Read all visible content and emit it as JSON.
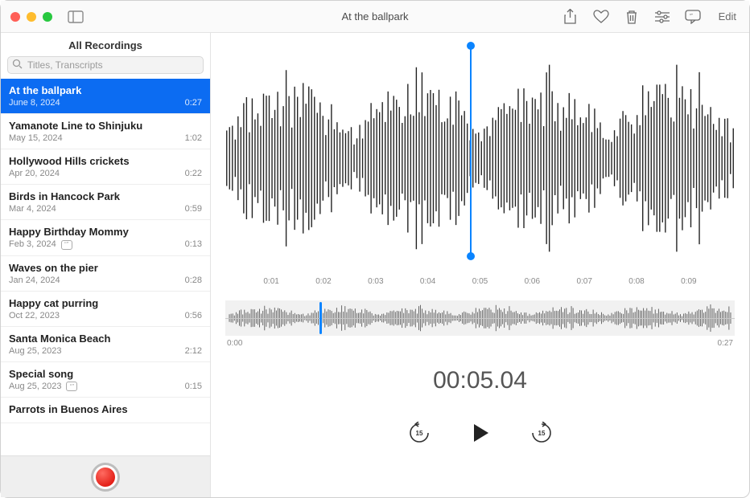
{
  "window": {
    "title": "At the ballpark",
    "edit_label": "Edit"
  },
  "sidebar": {
    "header": "All Recordings",
    "search_placeholder": "Titles, Transcripts",
    "recordings": [
      {
        "title": "At the ballpark",
        "date": "June 8, 2024",
        "duration": "0:27",
        "selected": true,
        "badge": false
      },
      {
        "title": "Yamanote Line to Shinjuku",
        "date": "May 15, 2024",
        "duration": "1:02",
        "selected": false,
        "badge": false
      },
      {
        "title": "Hollywood Hills crickets",
        "date": "Apr 20, 2024",
        "duration": "0:22",
        "selected": false,
        "badge": false
      },
      {
        "title": "Birds in Hancock Park",
        "date": "Mar 4, 2024",
        "duration": "0:59",
        "selected": false,
        "badge": false
      },
      {
        "title": "Happy Birthday Mommy",
        "date": "Feb 3, 2024",
        "duration": "0:13",
        "selected": false,
        "badge": true
      },
      {
        "title": "Waves on the pier",
        "date": "Jan 24, 2024",
        "duration": "0:28",
        "selected": false,
        "badge": false
      },
      {
        "title": "Happy cat purring",
        "date": "Oct 22, 2023",
        "duration": "0:56",
        "selected": false,
        "badge": false
      },
      {
        "title": "Santa Monica Beach",
        "date": "Aug 25, 2023",
        "duration": "2:12",
        "selected": false,
        "badge": false
      },
      {
        "title": "Special song",
        "date": "Aug 25, 2023",
        "duration": "0:15",
        "selected": false,
        "badge": true
      },
      {
        "title": "Parrots in Buenos Aires",
        "date": "",
        "duration": "",
        "selected": false,
        "badge": false
      }
    ]
  },
  "detail": {
    "axis_ticks": [
      "",
      "0:01",
      "0:02",
      "0:03",
      "0:04",
      "0:05",
      "0:06",
      "0:07",
      "0:08",
      "0:09",
      ""
    ],
    "overview_start": "0:00",
    "overview_end": "0:27",
    "current_time": "00:05.04",
    "skip_back_seconds": "15",
    "skip_forward_seconds": "15",
    "playhead_percent": 48,
    "overview_playhead_percent": 18.5
  },
  "colors": {
    "accent": "#0a84ff",
    "selection": "#0c6cf2"
  }
}
